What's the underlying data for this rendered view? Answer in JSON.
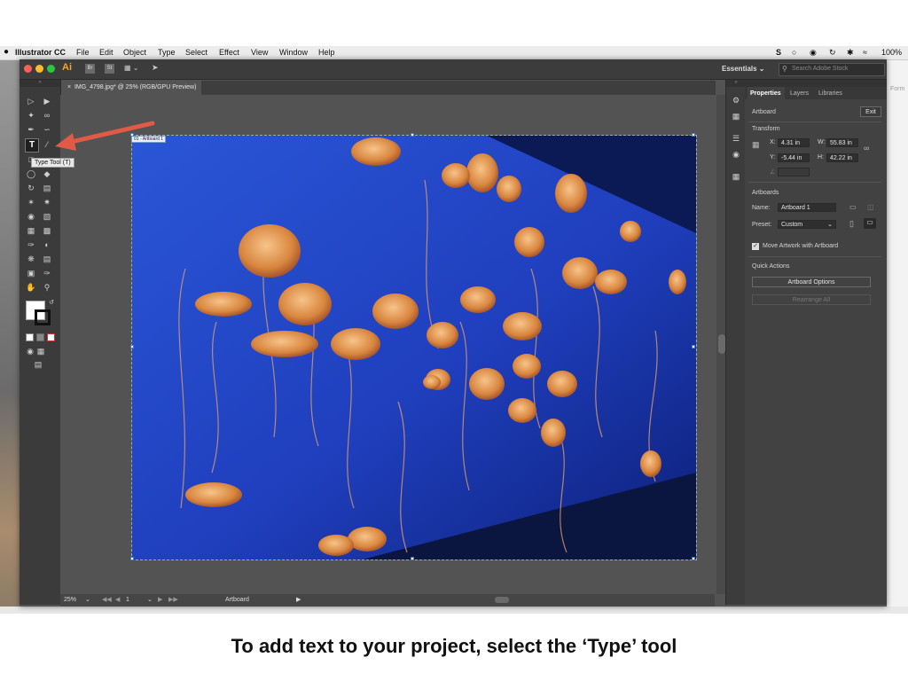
{
  "menubar": {
    "apple": "",
    "app_name": "Illustrator CC",
    "items": [
      "File",
      "Edit",
      "Object",
      "Type",
      "Select",
      "Effect",
      "View",
      "Window",
      "Help"
    ],
    "battery": "100%"
  },
  "titlebar": {
    "workspace": "Essentials",
    "search_placeholder": "Search Adobe Stock",
    "ai_logo": "Ai",
    "br": "Br",
    "st": "St"
  },
  "document": {
    "tab_title": "IMG_4798.jpg* @ 25% (RGB/GPU Preview)",
    "close": "×",
    "artboard_label": "01 - Artboard 1"
  },
  "tooltip": "Type Tool (T)",
  "statusbar": {
    "zoom": "25%",
    "page": "1",
    "mode": "Artboard"
  },
  "panel": {
    "tabs": [
      "Properties",
      "Layers",
      "Libraries"
    ],
    "artboard_heading": "Artboard",
    "exit": "Exit",
    "transform_heading": "Transform",
    "x_label": "X:",
    "x_value": "4.31 in",
    "y_label": "Y:",
    "y_value": "-5.44 in",
    "w_label": "W:",
    "w_value": "55.83 in",
    "h_label": "H:",
    "h_value": "42.22 in",
    "artboards_heading": "Artboards",
    "name_label": "Name:",
    "name_value": "Artboard 1",
    "preset_label": "Preset:",
    "preset_value": "Custom",
    "move_artwork": "Move Artwork with Artboard",
    "quick_actions": "Quick Actions",
    "artboard_options": "Artboard Options",
    "rearrange_all": "Rearrange All"
  },
  "caption": "To add text to your project, select the ‘Type’ tool",
  "colors": {
    "annotation_arrow": "#e05a45",
    "window_bg": "#535353",
    "artboard_water": "#1e45c8"
  }
}
